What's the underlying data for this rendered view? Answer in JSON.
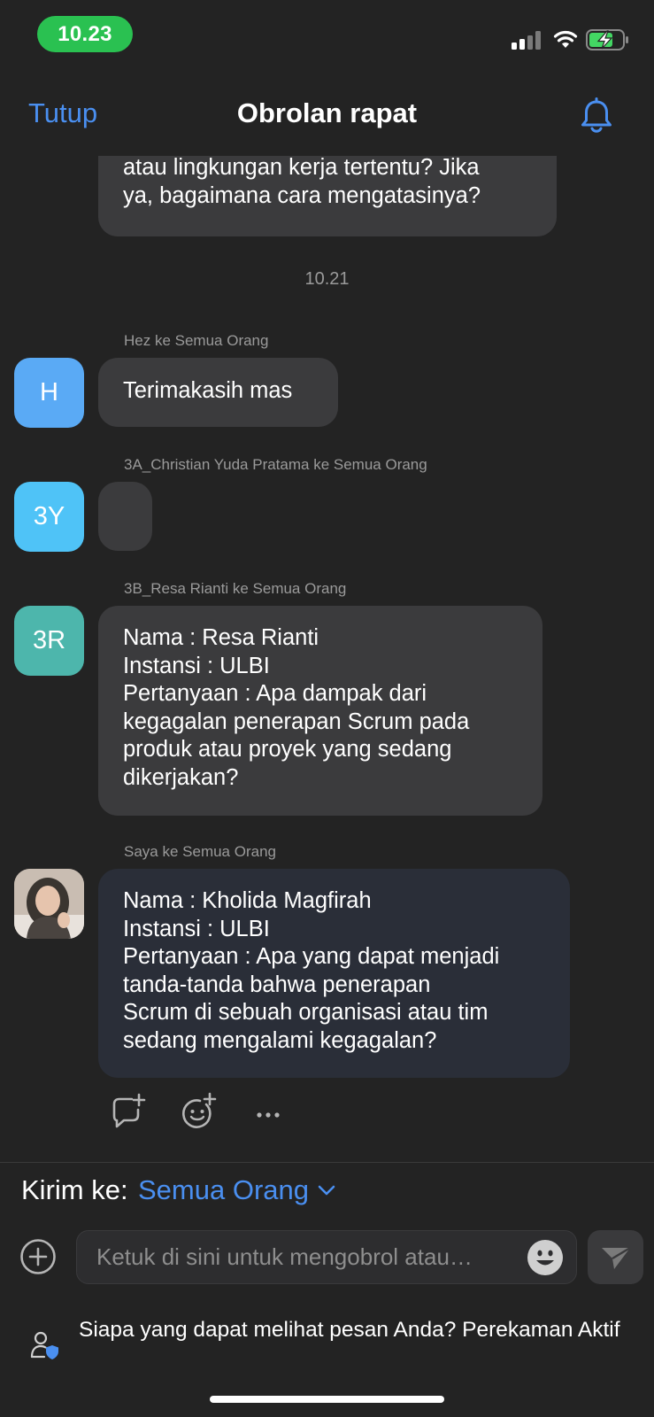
{
  "status_bar": {
    "time": "10.23"
  },
  "header": {
    "close_label": "Tutup",
    "title": "Obrolan rapat"
  },
  "chat": {
    "prev_message_lines": [
      "atau lingkungan kerja tertentu? Jika",
      "ya, bagaimana cara mengatasinya?"
    ],
    "timestamp": "10.21",
    "messages": [
      {
        "sender": "Hez ke Semua Orang",
        "avatar_initials": "H",
        "avatar_color": "#5aaaf5",
        "lines": [
          "Terimakasih mas"
        ]
      },
      {
        "sender": "3A_Christian Yuda Pratama ke Semua Orang",
        "avatar_initials": "3Y",
        "avatar_color": "#4fc3f7",
        "lines": []
      },
      {
        "sender": "3B_Resa Rianti ke Semua Orang",
        "avatar_initials": "3R",
        "avatar_color": "#4db6ac",
        "lines": [
          "Nama : Resa Rianti",
          "Instansi : ULBI",
          "Pertanyaan : Apa dampak dari",
          "kegagalan penerapan Scrum pada",
          "produk atau proyek yang sedang",
          "dikerjakan?"
        ]
      },
      {
        "sender": "Saya ke Semua Orang",
        "avatar_initials": "",
        "avatar_color": "#bfb2a8",
        "lines": [
          "Nama : Kholida Magfirah",
          "Instansi : ULBI",
          "Pertanyaan : Apa yang dapat menjadi",
          "tanda-tanda bahwa penerapan",
          "Scrum di sebuah organisasi atau tim",
          "sedang mengalami kegagalan?"
        ]
      }
    ]
  },
  "composer": {
    "send_to_label": "Kirim ke:",
    "send_to_value": "Semua Orang",
    "input_placeholder": "Ketuk di sini untuk mengobrol atau…",
    "privacy_text": "Siapa yang dapat melihat pesan Anda? Perekaman Aktif"
  },
  "colors": {
    "accent": "#4a8ff0",
    "background": "#232323",
    "bubble": "#3b3b3d",
    "own_bubble": "#2a2e38",
    "status_green": "#2ac151",
    "battery_charge": "#43d663"
  },
  "icons": {
    "bell": "bell-icon",
    "reply": "reply-add-icon",
    "react": "emoji-add-icon",
    "more": "more-icon",
    "add": "plus-circle-icon",
    "emoji": "emoji-icon",
    "send": "send-icon",
    "privacy": "user-shield-icon"
  }
}
